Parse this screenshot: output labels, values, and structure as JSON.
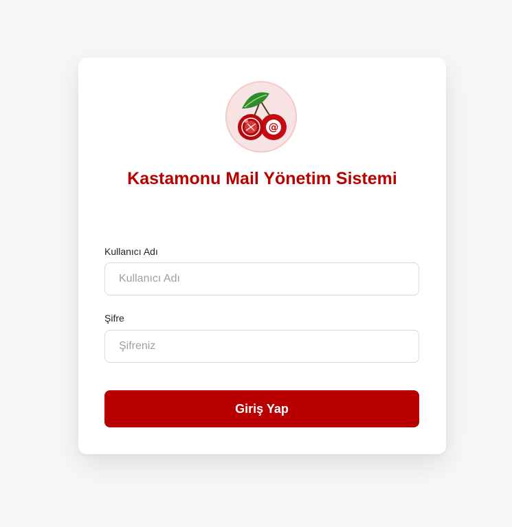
{
  "brand": {
    "title": "Kastamonu Mail Yönetim Sistemi",
    "accent_color": "#b80000",
    "logo_icon": "cherry-mail-logo"
  },
  "form": {
    "username": {
      "label": "Kullanıcı Adı",
      "placeholder": "Kullanıcı Adı",
      "value": ""
    },
    "password": {
      "label": "Şifre",
      "placeholder": "Şifreniz",
      "value": ""
    },
    "submit_label": "Giriş Yap"
  }
}
